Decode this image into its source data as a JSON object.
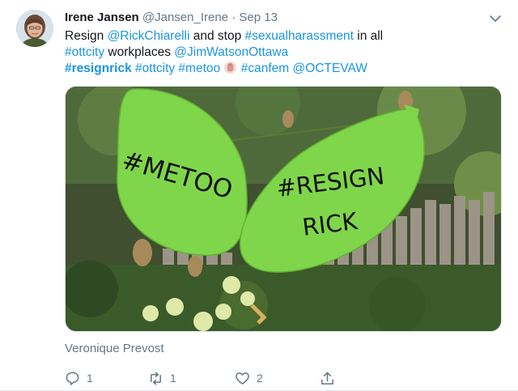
{
  "tweet": {
    "display_name": "Irene Jansen",
    "handle": "@Jansen_Irene",
    "separator": "·",
    "date": "Sep 13",
    "menu_icon": "chevron-down-icon",
    "text": {
      "l1_a": "Resign ",
      "l1_b": "@RickChiarelli",
      "l1_c": " and stop ",
      "l1_d": "#sexualharassment",
      "l1_e": " in all",
      "l2_a": "#ottcity",
      "l2_b": " workplaces ",
      "l2_c": "@JimWatsonOttawa",
      "l3_a": "#resignrick",
      "l3_b": " #ottcity #metoo",
      "l3_c": "#canfem",
      "l3_d": "@OCTEVAW"
    },
    "media": {
      "sign_left": "#METOO",
      "sign_right_1": "#RESIGN",
      "sign_right_2": "RICK"
    },
    "media_caption": "Veronique Prevost",
    "actions": {
      "reply_count": "1",
      "retweet_count": "1",
      "like_count": "2"
    },
    "colors": {
      "link": "#1b95e0",
      "muted": "#657786",
      "sign_green": "#7fd64a"
    }
  }
}
